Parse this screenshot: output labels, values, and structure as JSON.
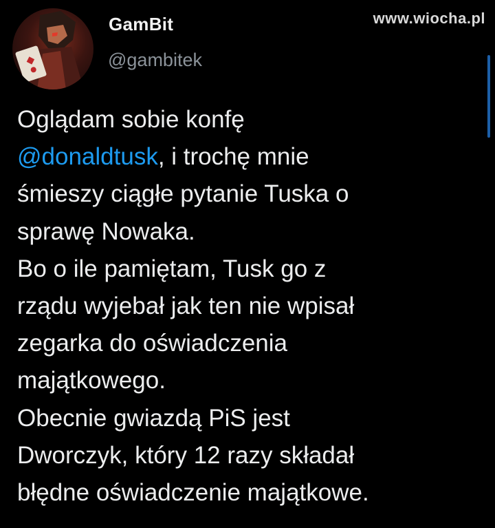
{
  "user": {
    "display_name": "GamBit",
    "handle": "@gambitek"
  },
  "watermark": "www.wiocha.pl",
  "tweet": {
    "mention": "@donaldtusk",
    "line1": "Oglądam sobie konfę",
    "line2_rest": ", i trochę mnie",
    "line3": "śmieszy ciągłe pytanie Tuska o",
    "line4": "sprawę Nowaka.",
    "line5": "Bo o ile pamiętam, Tusk go z",
    "line6": "rządu wyjebał jak ten nie wpisał",
    "line7": "zegarka do oświadczenia",
    "line8": "majątkowego.",
    "line9": "Obecnie gwiazdą PiS jest",
    "line10": "Dworczyk, który 12 razy składał",
    "line11": "błędne oświadczenie majątkowe."
  },
  "colors": {
    "background": "#000000",
    "mention": "#1d9bf0",
    "handle": "#8b9299",
    "text": "#ecedee"
  },
  "icons": {
    "avatar": "avatar-image",
    "scroll": "scroll-indicator"
  }
}
